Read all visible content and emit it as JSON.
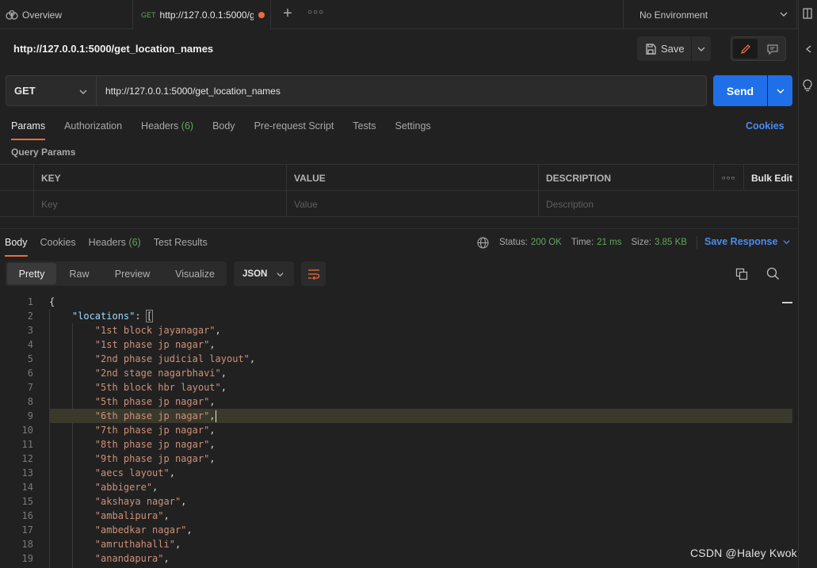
{
  "tabs": {
    "overview_label": "Overview",
    "active_method": "GET",
    "active_url": "http://127.0.0.1:5000/get_location_names",
    "environment": "No Environment"
  },
  "request": {
    "title": "http://127.0.0.1:5000/get_location_names",
    "save_label": "Save",
    "method": "GET",
    "url": "http://127.0.0.1:5000/get_location_names",
    "send_label": "Send"
  },
  "request_tabs": [
    {
      "label": "Params",
      "count": ""
    },
    {
      "label": "Authorization",
      "count": ""
    },
    {
      "label": "Headers",
      "count": "(6)"
    },
    {
      "label": "Body",
      "count": ""
    },
    {
      "label": "Pre-request Script",
      "count": ""
    },
    {
      "label": "Tests",
      "count": ""
    },
    {
      "label": "Settings",
      "count": ""
    }
  ],
  "cookies_link": "Cookies",
  "query_params": {
    "label": "Query Params",
    "headers": {
      "key": "KEY",
      "value": "VALUE",
      "description": "DESCRIPTION"
    },
    "bulk_edit": "Bulk Edit",
    "placeholders": {
      "key": "Key",
      "value": "Value",
      "description": "Description"
    }
  },
  "response_tabs": [
    {
      "label": "Body",
      "count": ""
    },
    {
      "label": "Cookies",
      "count": ""
    },
    {
      "label": "Headers",
      "count": "(6)"
    },
    {
      "label": "Test Results",
      "count": ""
    }
  ],
  "status": {
    "status_label": "Status:",
    "status_value": "200 OK",
    "time_label": "Time:",
    "time_value": "21 ms",
    "size_label": "Size:",
    "size_value": "3.85 KB",
    "save_response": "Save Response"
  },
  "view": {
    "modes": [
      "Pretty",
      "Raw",
      "Preview",
      "Visualize"
    ],
    "format": "JSON"
  },
  "code": {
    "key_name": "\"locations\"",
    "locations": [
      "1st block jayanagar",
      "1st phase jp nagar",
      "2nd phase judicial layout",
      "2nd stage nagarbhavi",
      "5th block hbr layout",
      "5th phase jp nagar",
      "6th phase jp nagar",
      "7th phase jp nagar",
      "8th phase jp nagar",
      "9th phase jp nagar",
      "aecs layout",
      "abbigere",
      "akshaya nagar",
      "ambalipura",
      "ambedkar nagar",
      "amruthahalli",
      "anandapura"
    ]
  },
  "watermark": "CSDN @Haley Kwok",
  "colors": {
    "accent_orange": "#f06b3c",
    "send_blue": "#1f6fe8",
    "status_green": "#61a65b",
    "link_blue": "#4a8cf0",
    "string_color": "#ce9178",
    "key_color": "#9cdcfe"
  }
}
